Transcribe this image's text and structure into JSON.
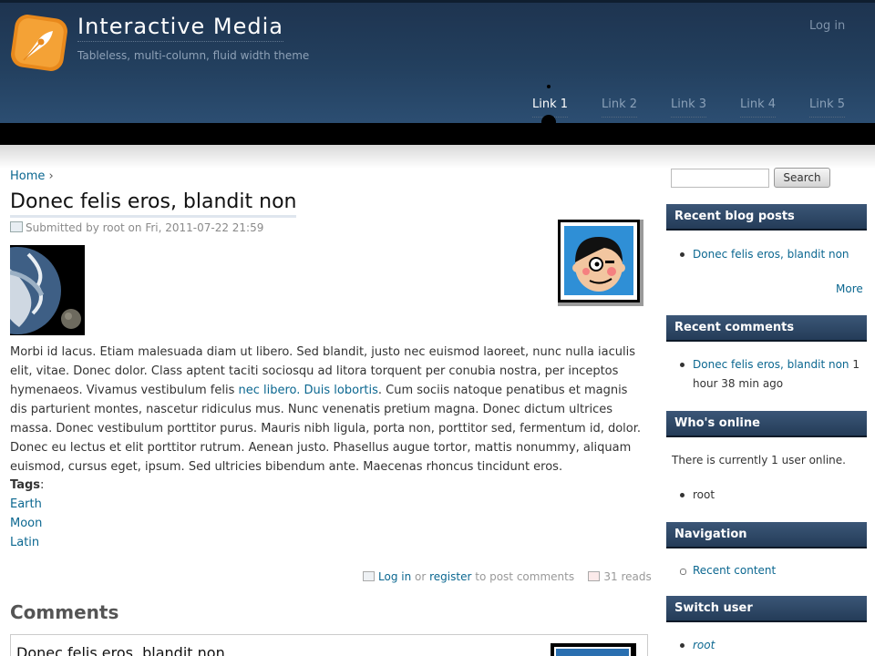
{
  "header": {
    "site_name": "Interactive Media",
    "slogan": "Tableless, multi-column, fluid width theme",
    "login": "Log in",
    "menu": [
      "Link 1",
      "Link 2",
      "Link 3",
      "Link 4",
      "Link 5"
    ],
    "active_menu": "Link 1"
  },
  "breadcrumb": {
    "home": "Home",
    "separator": "›"
  },
  "node": {
    "title": "Donec felis eros, blandit non",
    "submitted_by": "Submitted by",
    "author": "root",
    "on": "on",
    "date": "Fri, 2011-07-22 21:59",
    "body_part1": "Morbi id lacus. Etiam malesuada diam ut libero. Sed blandit, justo nec euismod laoreet, nunc nulla iaculis elit, vitae. Donec dolor. Class aptent taciti sociosqu ad litora torquent per conubia nostra, per inceptos hymenaeos. Vivamus vestibulum felis ",
    "body_link": "nec libero. Duis lobortis",
    "body_part2": ". Cum sociis natoque penatibus et magnis dis parturient montes, nascetur ridiculus mus. Nunc venenatis pretium magna. Donec dictum ultrices massa. Donec vestibulum porttitor purus. Mauris nibh ligula, porta non, porttitor sed, fermentum id, dolor. Donec eu lectus et elit porttitor rutrum. Aenean justo. Phasellus augue tortor, mattis nonummy, aliquam euismod, cursus eget, ipsum. Sed ultricies bibendum ante. Maecenas rhoncus tincidunt eros.",
    "tags_label": "Tags",
    "tags": [
      "Earth",
      "Moon",
      "Latin"
    ],
    "login_link": "Log in",
    "or": "or",
    "register_link": "register",
    "to_post": "to post comments",
    "reads": "31 reads"
  },
  "comments": {
    "heading": "Comments",
    "first_title": "Donec felis eros, blandit non"
  },
  "sidebar": {
    "search_placeholder": "",
    "search_button": "Search",
    "recent_posts": {
      "title": "Recent blog posts",
      "items": [
        "Donec felis eros, blandit non"
      ],
      "more": "More"
    },
    "recent_comments": {
      "title": "Recent comments",
      "link": "Donec felis eros, blandit non",
      "time_line1": "1",
      "time_line2": "hour 38 min ago"
    },
    "whos_online": {
      "title": "Who's online",
      "text": "There is currently 1 user online.",
      "users": [
        "root"
      ]
    },
    "navigation": {
      "title": "Navigation",
      "items": [
        "Recent content"
      ]
    },
    "switch_user": {
      "title": "Switch user",
      "items": [
        "root"
      ]
    }
  },
  "colors": {
    "header_bg": "#23405f",
    "link": "#0b6790",
    "block_title_bg": "#2c4766"
  }
}
